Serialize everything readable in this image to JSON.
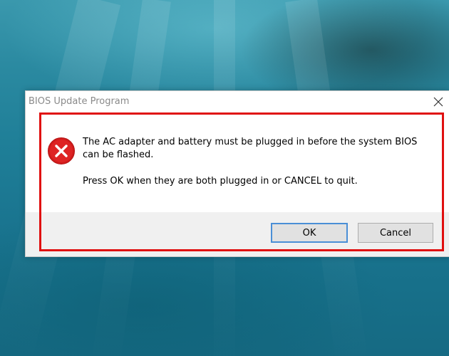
{
  "window": {
    "title": "BIOS Update Program"
  },
  "message": {
    "line1": "The AC adapter and battery must be plugged in before the system BIOS can be flashed.",
    "line2": "Press OK when they are both plugged in or CANCEL to quit."
  },
  "buttons": {
    "ok": "OK",
    "cancel": "Cancel"
  },
  "icons": {
    "error": "error-icon",
    "close": "close-icon"
  },
  "colors": {
    "highlight": "#e01010",
    "error_icon": "#d11c1c"
  }
}
